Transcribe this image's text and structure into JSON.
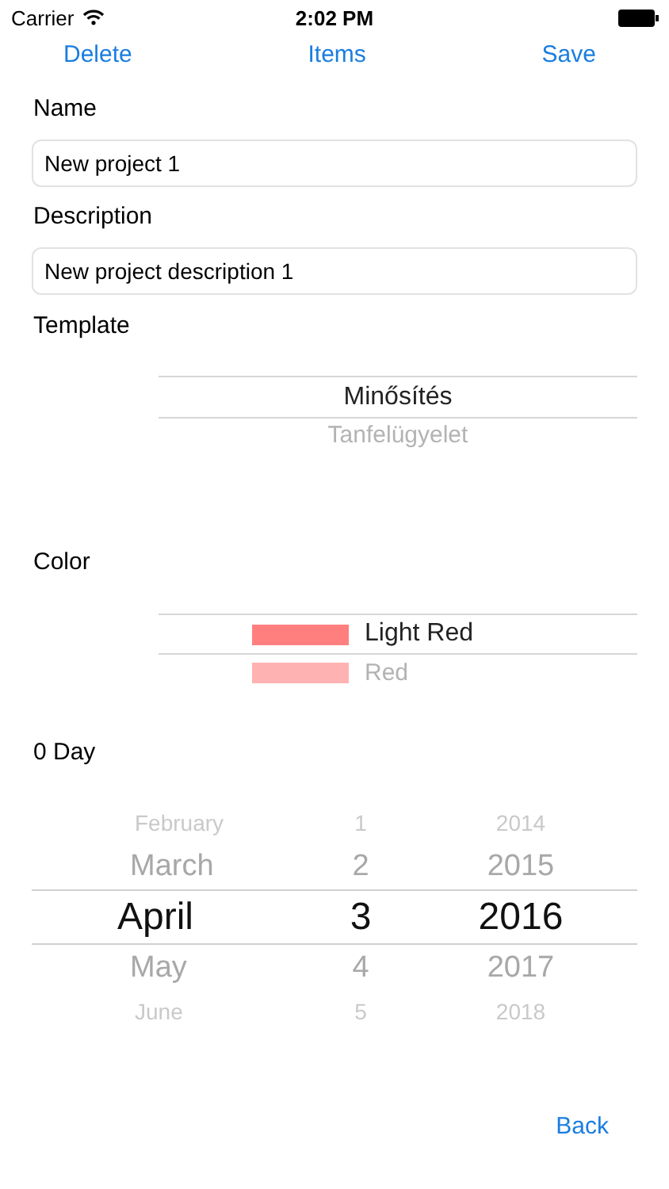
{
  "status_bar": {
    "carrier": "Carrier",
    "time": "2:02 PM"
  },
  "nav": {
    "left": "Delete",
    "title": "Items",
    "right": "Save"
  },
  "fields": [
    {
      "label": "Name",
      "value": "New project 1"
    },
    {
      "label": "Description",
      "value": "New project description 1"
    }
  ],
  "template": {
    "label": "Template",
    "options": [
      {
        "label": "Minősítés",
        "selected": true
      },
      {
        "label": "Tanfelügyelet",
        "selected": false
      }
    ]
  },
  "color": {
    "label": "Color",
    "options": [
      {
        "label": "Light Red",
        "color": "#ff7f7f",
        "selected": true
      },
      {
        "label": "Red",
        "color": "#ffb2b2",
        "selected": false
      }
    ]
  },
  "date": {
    "label": "0 Day",
    "rows": [
      {
        "month": "February",
        "day": "1",
        "year": "2014",
        "selected": false
      },
      {
        "month": "March",
        "day": "2",
        "year": "2015",
        "selected": false
      },
      {
        "month": "April",
        "day": "3",
        "year": "2016",
        "selected": true
      },
      {
        "month": "May",
        "day": "4",
        "year": "2017",
        "selected": false
      },
      {
        "month": "June",
        "day": "5",
        "year": "2018",
        "selected": false
      }
    ]
  },
  "footer": {
    "back": "Back"
  }
}
